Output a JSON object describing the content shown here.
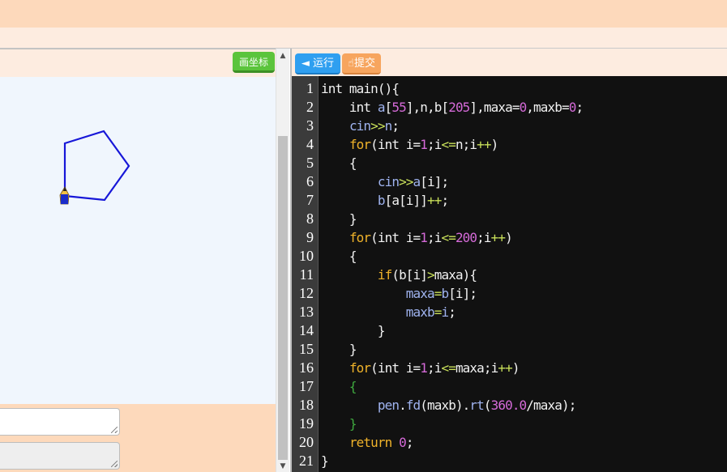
{
  "left": {
    "draw_button": "画坐标",
    "scroll_up": "▲",
    "scroll_down": "▼",
    "turtle": {
      "sides": 5,
      "stroke": "#1717d8",
      "pen_icon": "pen-icon"
    }
  },
  "right": {
    "run_button": "◄ 运行",
    "submit_button": "提交",
    "submit_icon": "hand-icon"
  },
  "colors": {
    "keyword": "#f0b32a",
    "number": "#d56ad8",
    "operator": "#c9e05a",
    "identifier": "#9fb3ef",
    "brace_green": "#3faa3f",
    "plain": "#f2f2f2"
  },
  "code": [
    [
      [
        "plain",
        "int main(){"
      ]
    ],
    [
      [
        "plain",
        "    int "
      ],
      [
        "identifier",
        "a"
      ],
      [
        "plain",
        "["
      ],
      [
        "number",
        "55"
      ],
      [
        "plain",
        "],n,b["
      ],
      [
        "number",
        "205"
      ],
      [
        "plain",
        "],maxa="
      ],
      [
        "number",
        "0"
      ],
      [
        "plain",
        ",maxb="
      ],
      [
        "number",
        "0"
      ],
      [
        "plain",
        ";"
      ]
    ],
    [
      [
        "plain",
        "    "
      ],
      [
        "identifier",
        "cin"
      ],
      [
        "operator",
        ">>"
      ],
      [
        "identifier",
        "n"
      ],
      [
        "plain",
        ";"
      ]
    ],
    [
      [
        "plain",
        "    "
      ],
      [
        "keyword",
        "for"
      ],
      [
        "plain",
        "(int i="
      ],
      [
        "number",
        "1"
      ],
      [
        "plain",
        ";i"
      ],
      [
        "operator",
        "<="
      ],
      [
        "plain",
        "n;i"
      ],
      [
        "operator",
        "++"
      ],
      [
        "plain",
        ")"
      ]
    ],
    [
      [
        "plain",
        "    {"
      ]
    ],
    [
      [
        "plain",
        "        "
      ],
      [
        "identifier",
        "cin"
      ],
      [
        "operator",
        ">>"
      ],
      [
        "identifier",
        "a"
      ],
      [
        "plain",
        "[i];"
      ]
    ],
    [
      [
        "plain",
        "        "
      ],
      [
        "identifier",
        "b"
      ],
      [
        "plain",
        "[a[i]]"
      ],
      [
        "operator",
        "++"
      ],
      [
        "plain",
        ";"
      ]
    ],
    [
      [
        "plain",
        "    }"
      ]
    ],
    [
      [
        "plain",
        "    "
      ],
      [
        "keyword",
        "for"
      ],
      [
        "plain",
        "(int i="
      ],
      [
        "number",
        "1"
      ],
      [
        "plain",
        ";i"
      ],
      [
        "operator",
        "<="
      ],
      [
        "number",
        "200"
      ],
      [
        "plain",
        ";i"
      ],
      [
        "operator",
        "++"
      ],
      [
        "plain",
        ")"
      ]
    ],
    [
      [
        "plain",
        "    {"
      ]
    ],
    [
      [
        "plain",
        "        "
      ],
      [
        "keyword",
        "if"
      ],
      [
        "plain",
        "(b[i]"
      ],
      [
        "operator",
        ">"
      ],
      [
        "plain",
        "maxa){"
      ]
    ],
    [
      [
        "plain",
        "            "
      ],
      [
        "identifier",
        "maxa"
      ],
      [
        "operator",
        "="
      ],
      [
        "identifier",
        "b"
      ],
      [
        "plain",
        "[i];"
      ]
    ],
    [
      [
        "plain",
        "            "
      ],
      [
        "identifier",
        "maxb"
      ],
      [
        "operator",
        "="
      ],
      [
        "identifier",
        "i"
      ],
      [
        "plain",
        ";"
      ]
    ],
    [
      [
        "plain",
        "        }"
      ]
    ],
    [
      [
        "plain",
        "    }"
      ]
    ],
    [
      [
        "plain",
        "    "
      ],
      [
        "keyword",
        "for"
      ],
      [
        "plain",
        "(int i="
      ],
      [
        "number",
        "1"
      ],
      [
        "plain",
        ";i"
      ],
      [
        "operator",
        "<="
      ],
      [
        "plain",
        "maxa;i"
      ],
      [
        "operator",
        "++"
      ],
      [
        "plain",
        ")"
      ]
    ],
    [
      [
        "brace_green",
        "    {"
      ]
    ],
    [
      [
        "plain",
        "        "
      ],
      [
        "identifier",
        "pen"
      ],
      [
        "plain",
        "."
      ],
      [
        "identifier",
        "fd"
      ],
      [
        "plain",
        "(maxb)."
      ],
      [
        "identifier",
        "rt"
      ],
      [
        "plain",
        "("
      ],
      [
        "number",
        "360.0"
      ],
      [
        "plain",
        "/maxa);"
      ]
    ],
    [
      [
        "brace_green",
        "    }"
      ]
    ],
    [
      [
        "plain",
        "    "
      ],
      [
        "keyword",
        "return"
      ],
      [
        "plain",
        " "
      ],
      [
        "number",
        "0"
      ],
      [
        "plain",
        ";"
      ]
    ],
    [
      [
        "plain",
        "}"
      ]
    ]
  ]
}
